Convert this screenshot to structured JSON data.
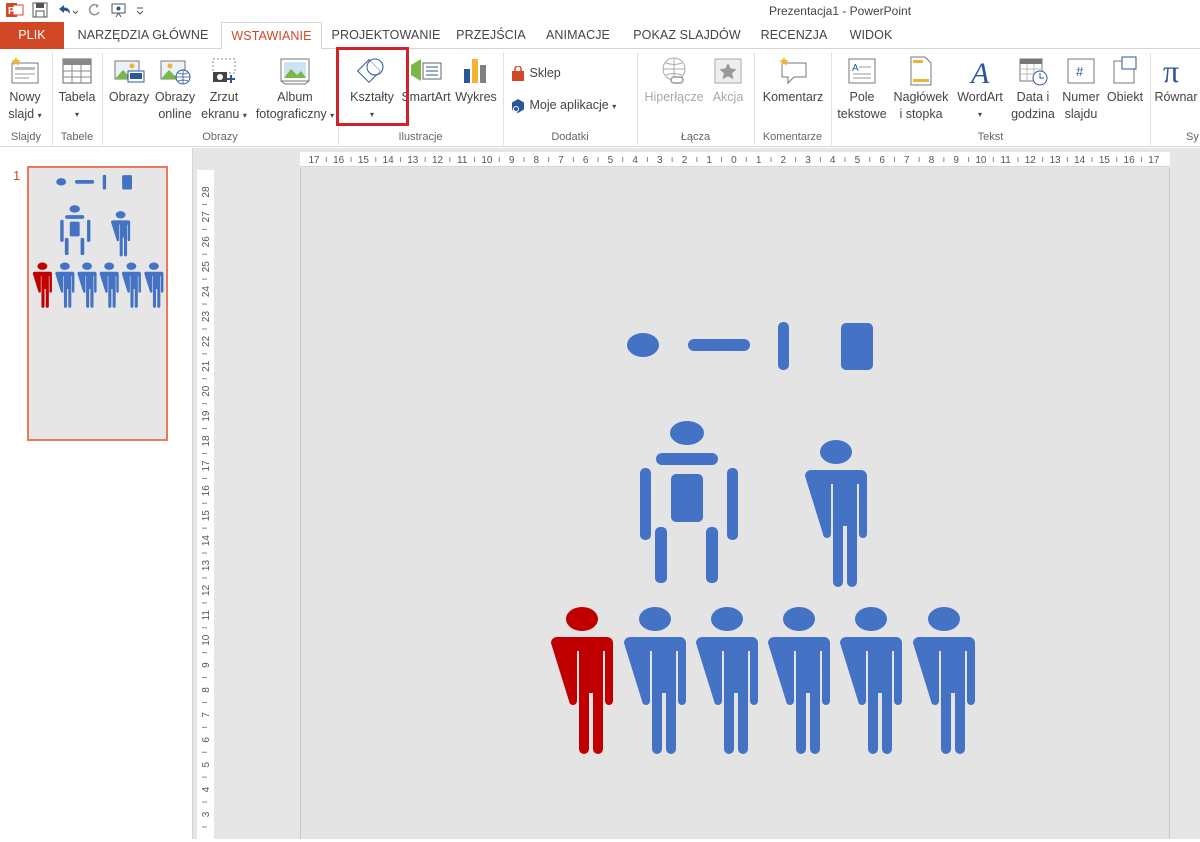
{
  "window": {
    "title": "Prezentacja1 - PowerPoint"
  },
  "tabs": [
    {
      "label": "PLIK"
    },
    {
      "label": "NARZĘDZIA GŁÓWNE"
    },
    {
      "label": "WSTAWIANIE"
    },
    {
      "label": "PROJEKTOWANIE"
    },
    {
      "label": "PRZEJŚCIA"
    },
    {
      "label": "ANIMACJE"
    },
    {
      "label": "POKAZ SLAJDÓW"
    },
    {
      "label": "RECENZJA"
    },
    {
      "label": "WIDOK"
    }
  ],
  "ribbon": {
    "nowy_slajd": {
      "line1": "Nowy",
      "line2": "slajd"
    },
    "tabela": {
      "label": "Tabela"
    },
    "obrazy": {
      "label": "Obrazy"
    },
    "obrazy_online": {
      "line1": "Obrazy",
      "line2": "online"
    },
    "zrzut": {
      "line1": "Zrzut",
      "line2": "ekranu"
    },
    "album": {
      "line1": "Album",
      "line2": "fotograficzny"
    },
    "ksztalty": {
      "label": "Kształty"
    },
    "smartart": {
      "label": "SmartArt"
    },
    "wykres": {
      "label": "Wykres"
    },
    "sklep": {
      "label": "Sklep"
    },
    "moje_aplikacje": {
      "label": "Moje aplikacje"
    },
    "hiperlacze": {
      "label": "Hiperłącze"
    },
    "akcja": {
      "label": "Akcja"
    },
    "komentarz": {
      "label": "Komentarz"
    },
    "pole": {
      "line1": "Pole",
      "line2": "tekstowe"
    },
    "naglowek": {
      "line1": "Nagłówek",
      "line2": "i stopka"
    },
    "wordart": {
      "label": "WordArt"
    },
    "data": {
      "line1": "Data i",
      "line2": "godzina"
    },
    "numer": {
      "line1": "Numer",
      "line2": "slajdu"
    },
    "obiekt": {
      "label": "Obiekt"
    },
    "rownanie": {
      "label": "Równar"
    },
    "groups": {
      "slajdy": "Slajdy",
      "tabele": "Tabele",
      "obrazy": "Obrazy",
      "ilustracje": "Ilustracje",
      "dodatki": "Dodatki",
      "lacza": "Łącza",
      "komentarze": "Komentarze",
      "tekst": "Tekst",
      "sy": "Sy"
    }
  },
  "thumbnails": {
    "number": "1"
  },
  "ruler": {
    "h_ticks": [
      "17",
      "16",
      "15",
      "14",
      "13",
      "12",
      "11",
      "10",
      "9",
      "8",
      "7",
      "6",
      "5",
      "4",
      "3",
      "2",
      "1",
      "0",
      "1",
      "2",
      "3",
      "4",
      "5",
      "6",
      "7",
      "8",
      "9",
      "10",
      "11",
      "12",
      "13",
      "14",
      "15",
      "16",
      "17"
    ],
    "v_ticks": [
      "28",
      "27",
      "26",
      "25",
      "24",
      "23",
      "22",
      "21",
      "20",
      "19",
      "18",
      "17",
      "16",
      "15",
      "14",
      "13",
      "12",
      "11",
      "10",
      "9",
      "8",
      "7",
      "6",
      "5",
      "4",
      "3"
    ]
  },
  "colors": {
    "accent": "#d24726",
    "shape_blue": "#4472c4",
    "shape_red": "#c00000",
    "highlight": "#d2232a"
  }
}
